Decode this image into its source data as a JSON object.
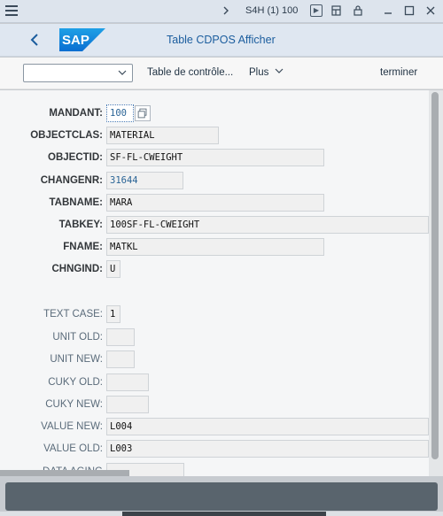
{
  "titlebar": {
    "system": "S4H (1) 100"
  },
  "shell": {
    "logo_text": "SAP",
    "title": "Table CDPOS Afficher"
  },
  "toolbar": {
    "dropdown_value": "",
    "control_table": "Table de contrôle...",
    "more": "Plus",
    "finish": "terminer"
  },
  "fields": [
    {
      "label": "MANDANT:",
      "value": "100"
    },
    {
      "label": "OBJECTCLAS:",
      "value": "MATERIAL"
    },
    {
      "label": "OBJECTID:",
      "value": "SF-FL-CWEIGHT"
    },
    {
      "label": "CHANGENR:",
      "value": "31644"
    },
    {
      "label": "TABNAME:",
      "value": "MARA"
    },
    {
      "label": "TABKEY:",
      "value": "100SF-FL-CWEIGHT"
    },
    {
      "label": "FNAME:",
      "value": "MATKL"
    },
    {
      "label": "CHNGIND:",
      "value": "U"
    },
    {
      "label": "TEXT CASE:",
      "value": "1"
    },
    {
      "label": "UNIT OLD:",
      "value": ""
    },
    {
      "label": "UNIT NEW:",
      "value": ""
    },
    {
      "label": "CUKY OLD:",
      "value": ""
    },
    {
      "label": "CUKY NEW:",
      "value": ""
    },
    {
      "label": "VALUE NEW:",
      "value": "L004"
    },
    {
      "label": "VALUE OLD:",
      "value": "L003"
    },
    {
      "label": "DATA AGING",
      "value": ""
    }
  ],
  "colors": {
    "accent": "#1b5d9e",
    "sap_blue": "#0a6ed1",
    "statusbar": "#59646d"
  }
}
